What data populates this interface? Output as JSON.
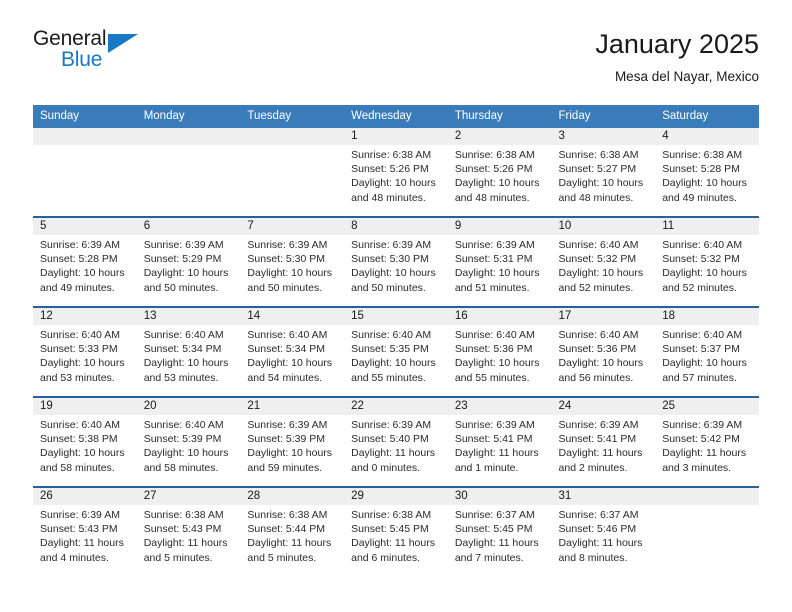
{
  "brand": {
    "line1": "General",
    "line2": "Blue",
    "triangle_color": "#1878c4"
  },
  "header": {
    "title": "January 2025",
    "subtitle": "Mesa del Nayar, Mexico"
  },
  "theme": {
    "header_bg": "#3a7cba",
    "row_separator": "#2a6099",
    "date_band_bg": "#efefef",
    "text": "#1a1a1a"
  },
  "weekdays": [
    "Sunday",
    "Monday",
    "Tuesday",
    "Wednesday",
    "Thursday",
    "Friday",
    "Saturday"
  ],
  "labels": {
    "sunrise": "Sunrise:",
    "sunset": "Sunset:",
    "daylight": "Daylight:"
  },
  "weeks": [
    [
      {
        "date": ""
      },
      {
        "date": ""
      },
      {
        "date": ""
      },
      {
        "date": "1",
        "sunrise": "Sunrise: 6:38 AM",
        "sunset": "Sunset: 5:26 PM",
        "daylight": "Daylight: 10 hours and 48 minutes."
      },
      {
        "date": "2",
        "sunrise": "Sunrise: 6:38 AM",
        "sunset": "Sunset: 5:26 PM",
        "daylight": "Daylight: 10 hours and 48 minutes."
      },
      {
        "date": "3",
        "sunrise": "Sunrise: 6:38 AM",
        "sunset": "Sunset: 5:27 PM",
        "daylight": "Daylight: 10 hours and 48 minutes."
      },
      {
        "date": "4",
        "sunrise": "Sunrise: 6:38 AM",
        "sunset": "Sunset: 5:28 PM",
        "daylight": "Daylight: 10 hours and 49 minutes."
      }
    ],
    [
      {
        "date": "5",
        "sunrise": "Sunrise: 6:39 AM",
        "sunset": "Sunset: 5:28 PM",
        "daylight": "Daylight: 10 hours and 49 minutes."
      },
      {
        "date": "6",
        "sunrise": "Sunrise: 6:39 AM",
        "sunset": "Sunset: 5:29 PM",
        "daylight": "Daylight: 10 hours and 50 minutes."
      },
      {
        "date": "7",
        "sunrise": "Sunrise: 6:39 AM",
        "sunset": "Sunset: 5:30 PM",
        "daylight": "Daylight: 10 hours and 50 minutes."
      },
      {
        "date": "8",
        "sunrise": "Sunrise: 6:39 AM",
        "sunset": "Sunset: 5:30 PM",
        "daylight": "Daylight: 10 hours and 50 minutes."
      },
      {
        "date": "9",
        "sunrise": "Sunrise: 6:39 AM",
        "sunset": "Sunset: 5:31 PM",
        "daylight": "Daylight: 10 hours and 51 minutes."
      },
      {
        "date": "10",
        "sunrise": "Sunrise: 6:40 AM",
        "sunset": "Sunset: 5:32 PM",
        "daylight": "Daylight: 10 hours and 52 minutes."
      },
      {
        "date": "11",
        "sunrise": "Sunrise: 6:40 AM",
        "sunset": "Sunset: 5:32 PM",
        "daylight": "Daylight: 10 hours and 52 minutes."
      }
    ],
    [
      {
        "date": "12",
        "sunrise": "Sunrise: 6:40 AM",
        "sunset": "Sunset: 5:33 PM",
        "daylight": "Daylight: 10 hours and 53 minutes."
      },
      {
        "date": "13",
        "sunrise": "Sunrise: 6:40 AM",
        "sunset": "Sunset: 5:34 PM",
        "daylight": "Daylight: 10 hours and 53 minutes."
      },
      {
        "date": "14",
        "sunrise": "Sunrise: 6:40 AM",
        "sunset": "Sunset: 5:34 PM",
        "daylight": "Daylight: 10 hours and 54 minutes."
      },
      {
        "date": "15",
        "sunrise": "Sunrise: 6:40 AM",
        "sunset": "Sunset: 5:35 PM",
        "daylight": "Daylight: 10 hours and 55 minutes."
      },
      {
        "date": "16",
        "sunrise": "Sunrise: 6:40 AM",
        "sunset": "Sunset: 5:36 PM",
        "daylight": "Daylight: 10 hours and 55 minutes."
      },
      {
        "date": "17",
        "sunrise": "Sunrise: 6:40 AM",
        "sunset": "Sunset: 5:36 PM",
        "daylight": "Daylight: 10 hours and 56 minutes."
      },
      {
        "date": "18",
        "sunrise": "Sunrise: 6:40 AM",
        "sunset": "Sunset: 5:37 PM",
        "daylight": "Daylight: 10 hours and 57 minutes."
      }
    ],
    [
      {
        "date": "19",
        "sunrise": "Sunrise: 6:40 AM",
        "sunset": "Sunset: 5:38 PM",
        "daylight": "Daylight: 10 hours and 58 minutes."
      },
      {
        "date": "20",
        "sunrise": "Sunrise: 6:40 AM",
        "sunset": "Sunset: 5:39 PM",
        "daylight": "Daylight: 10 hours and 58 minutes."
      },
      {
        "date": "21",
        "sunrise": "Sunrise: 6:39 AM",
        "sunset": "Sunset: 5:39 PM",
        "daylight": "Daylight: 10 hours and 59 minutes."
      },
      {
        "date": "22",
        "sunrise": "Sunrise: 6:39 AM",
        "sunset": "Sunset: 5:40 PM",
        "daylight": "Daylight: 11 hours and 0 minutes."
      },
      {
        "date": "23",
        "sunrise": "Sunrise: 6:39 AM",
        "sunset": "Sunset: 5:41 PM",
        "daylight": "Daylight: 11 hours and 1 minute."
      },
      {
        "date": "24",
        "sunrise": "Sunrise: 6:39 AM",
        "sunset": "Sunset: 5:41 PM",
        "daylight": "Daylight: 11 hours and 2 minutes."
      },
      {
        "date": "25",
        "sunrise": "Sunrise: 6:39 AM",
        "sunset": "Sunset: 5:42 PM",
        "daylight": "Daylight: 11 hours and 3 minutes."
      }
    ],
    [
      {
        "date": "26",
        "sunrise": "Sunrise: 6:39 AM",
        "sunset": "Sunset: 5:43 PM",
        "daylight": "Daylight: 11 hours and 4 minutes."
      },
      {
        "date": "27",
        "sunrise": "Sunrise: 6:38 AM",
        "sunset": "Sunset: 5:43 PM",
        "daylight": "Daylight: 11 hours and 5 minutes."
      },
      {
        "date": "28",
        "sunrise": "Sunrise: 6:38 AM",
        "sunset": "Sunset: 5:44 PM",
        "daylight": "Daylight: 11 hours and 5 minutes."
      },
      {
        "date": "29",
        "sunrise": "Sunrise: 6:38 AM",
        "sunset": "Sunset: 5:45 PM",
        "daylight": "Daylight: 11 hours and 6 minutes."
      },
      {
        "date": "30",
        "sunrise": "Sunrise: 6:37 AM",
        "sunset": "Sunset: 5:45 PM",
        "daylight": "Daylight: 11 hours and 7 minutes."
      },
      {
        "date": "31",
        "sunrise": "Sunrise: 6:37 AM",
        "sunset": "Sunset: 5:46 PM",
        "daylight": "Daylight: 11 hours and 8 minutes."
      },
      {
        "date": ""
      }
    ]
  ]
}
